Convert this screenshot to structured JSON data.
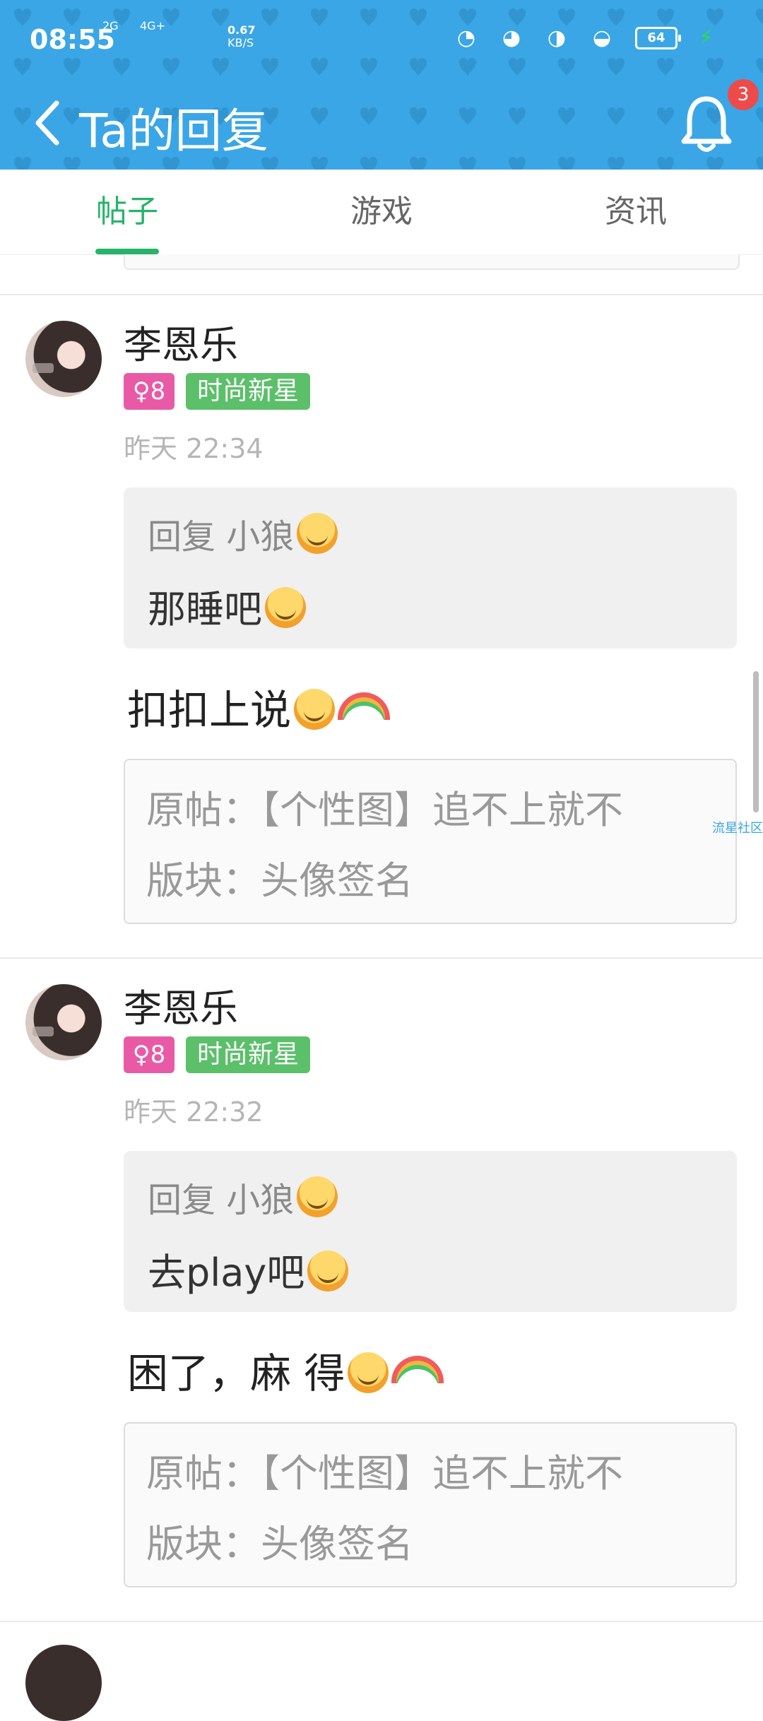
{
  "status_bar": {
    "time": "08:55",
    "net1": "2G",
    "net2": "4G+",
    "speed_value": "0.67",
    "speed_unit": "KB/S",
    "battery": "64"
  },
  "header": {
    "title": "Ta的回复",
    "notification_count": "3",
    "background_color": "#3aa6e6"
  },
  "tabs": [
    {
      "label": "帖子",
      "active": true
    },
    {
      "label": "游戏",
      "active": false
    },
    {
      "label": "资讯",
      "active": false
    }
  ],
  "posts": [
    {
      "username": "李恩乐",
      "gender_badge": "♀8",
      "level_badge": "时尚新星",
      "time": "昨天 22:34",
      "quote_head": "回复 小狼",
      "quote_text": "那睡吧",
      "reply_text": "扣扣上说",
      "source_line": "原帖：【个性图】追不上就不",
      "board_line": "版块：头像签名"
    },
    {
      "username": "李恩乐",
      "gender_badge": "♀8",
      "level_badge": "时尚新星",
      "time": "昨天 22:32",
      "quote_head": "回复 小狼",
      "quote_text": "去play吧",
      "reply_text": "困了，麻  得",
      "source_line": "原帖：【个性图】追不上就不",
      "board_line": "版块：头像签名"
    }
  ],
  "watermark": "流星社区"
}
